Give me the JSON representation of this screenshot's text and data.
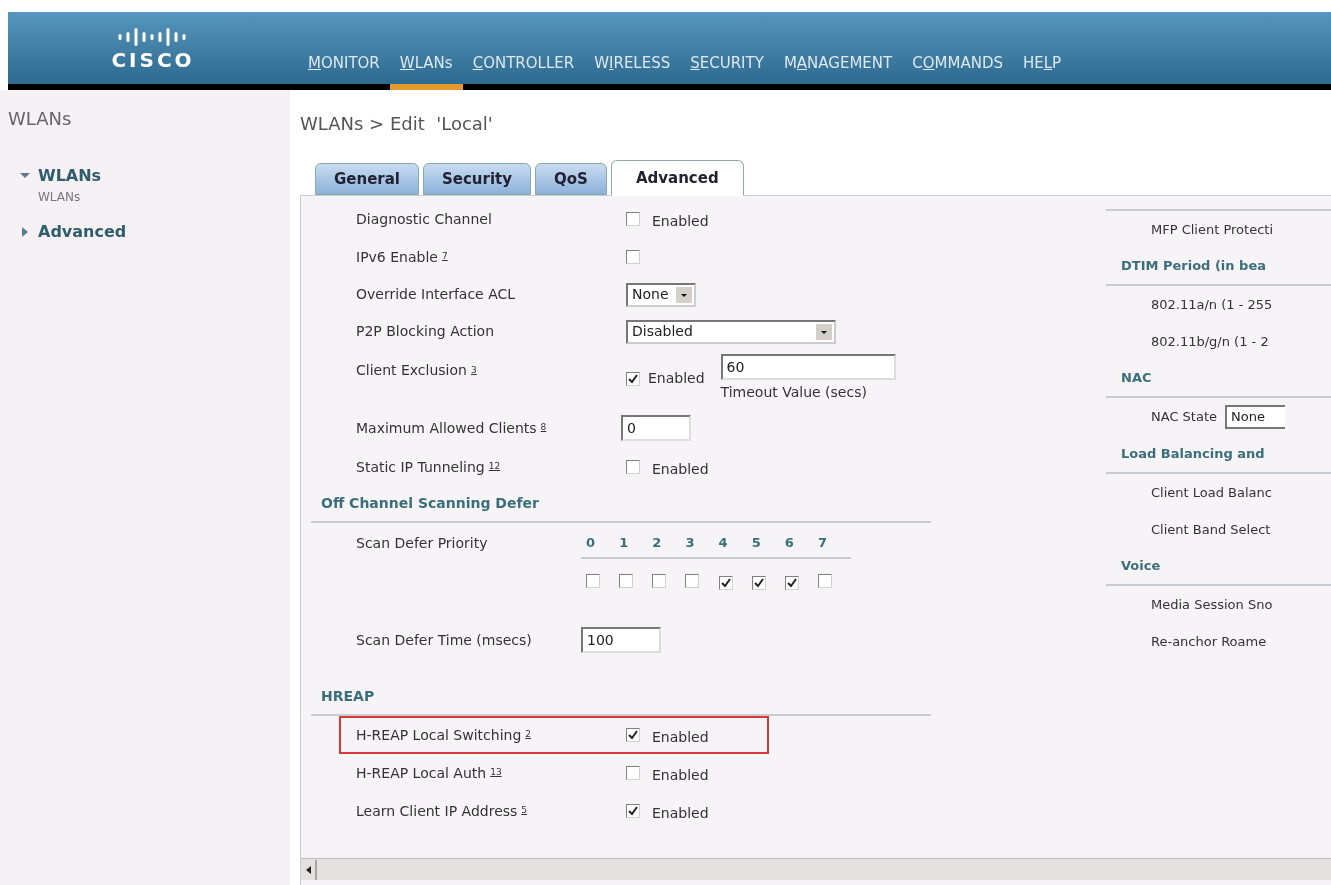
{
  "header": {
    "logo_text": "CISCO",
    "nav": [
      {
        "key": "M",
        "post": "ONITOR",
        "selected": false
      },
      {
        "key": "W",
        "post": "LANs",
        "selected": true
      },
      {
        "key": "C",
        "post": "ONTROLLER",
        "selected": false
      },
      {
        "pre": "W",
        "key": "I",
        "post": "RELESS",
        "selected": false
      },
      {
        "key": "S",
        "post": "ECURITY",
        "selected": false
      },
      {
        "pre": "M",
        "key": "A",
        "post": "NAGEMENT",
        "selected": false
      },
      {
        "pre": "C",
        "key": "O",
        "post": "MMANDS",
        "selected": false
      },
      {
        "pre": "HE",
        "key": "L",
        "post": "P",
        "selected": false
      }
    ]
  },
  "sidebar": {
    "title": "WLANs",
    "items": [
      {
        "label": "WLANs",
        "expanded": true,
        "children": [
          {
            "label": "WLANs"
          }
        ]
      },
      {
        "label": "Advanced",
        "expanded": false
      }
    ]
  },
  "page_title": "WLANs > Edit  'Local'",
  "tabs": [
    {
      "label": "General",
      "selected": false
    },
    {
      "label": "Security",
      "selected": false
    },
    {
      "label": "QoS",
      "selected": false
    },
    {
      "label": "Advanced",
      "selected": true
    }
  ],
  "left_rows": [
    {
      "kind": "checkbox",
      "label": "Diagnostic Channel",
      "checked": false,
      "text": "Enabled",
      "highlighted": false
    },
    {
      "kind": "checkbox",
      "label": "IPv6 Enable",
      "note": "7",
      "checked": false,
      "highlighted": false
    },
    {
      "kind": "select",
      "label": "Override Interface ACL",
      "value": "None"
    },
    {
      "kind": "wideselect",
      "label": "P2P Blocking Action",
      "value": "Disabled"
    },
    {
      "kind": "exclusion",
      "label": "Client Exclusion",
      "note": "3",
      "checked": true,
      "text": "Enabled",
      "value": "60",
      "caption": "Timeout Value (secs)"
    },
    {
      "kind": "input",
      "label": "Maximum Allowed Clients",
      "note": "8",
      "value": "0"
    },
    {
      "kind": "checkbox",
      "label": "Static IP Tunneling",
      "note": "12",
      "checked": false,
      "text": "Enabled",
      "highlighted": false
    },
    {
      "kind": "heading",
      "label": "Off Channel Scanning Defer"
    },
    {
      "kind": "priority",
      "label": "Scan Defer Priority",
      "levels": [
        {
          "label": "0",
          "checked": false
        },
        {
          "label": "1",
          "checked": false
        },
        {
          "label": "2",
          "checked": false
        },
        {
          "label": "3",
          "checked": false
        },
        {
          "label": "4",
          "checked": true
        },
        {
          "label": "5",
          "checked": true
        },
        {
          "label": "6",
          "checked": true
        },
        {
          "label": "7",
          "checked": false
        }
      ]
    },
    {
      "kind": "tallinput",
      "label": "Scan Defer Time (msecs)",
      "value": "100"
    },
    {
      "kind": "heading",
      "label": "HREAP"
    },
    {
      "kind": "checkbox",
      "label": "H-REAP Local Switching",
      "note": "2",
      "checked": true,
      "text": "Enabled",
      "highlighted": true
    },
    {
      "kind": "checkbox",
      "label": "H-REAP Local Auth",
      "note": "13",
      "checked": false,
      "text": "Enabled",
      "highlighted": false
    },
    {
      "kind": "checkbox",
      "label": "Learn Client IP Address",
      "note": "5",
      "checked": true,
      "text": "Enabled",
      "highlighted": false
    }
  ],
  "right_rows": [
    {
      "kind": "rule"
    },
    {
      "kind": "text",
      "label": "MFP Client Protecti"
    },
    {
      "kind": "heading",
      "label": "DTIM Period (in bea"
    },
    {
      "kind": "text",
      "label": "802.11a/n (1 - 255"
    },
    {
      "kind": "text",
      "label": "802.11b/g/n (1 - 2"
    },
    {
      "kind": "heading",
      "label": "NAC"
    },
    {
      "kind": "select",
      "label": "NAC State",
      "value": "None"
    },
    {
      "kind": "heading",
      "label": "Load Balancing and"
    },
    {
      "kind": "text",
      "label": "Client Load Balanc"
    },
    {
      "kind": "text",
      "label": "Client Band Select"
    },
    {
      "kind": "heading",
      "label": "Voice"
    },
    {
      "kind": "text",
      "label": "Media Session Sno"
    },
    {
      "kind": "text",
      "label": "Re-anchor Roame"
    }
  ]
}
